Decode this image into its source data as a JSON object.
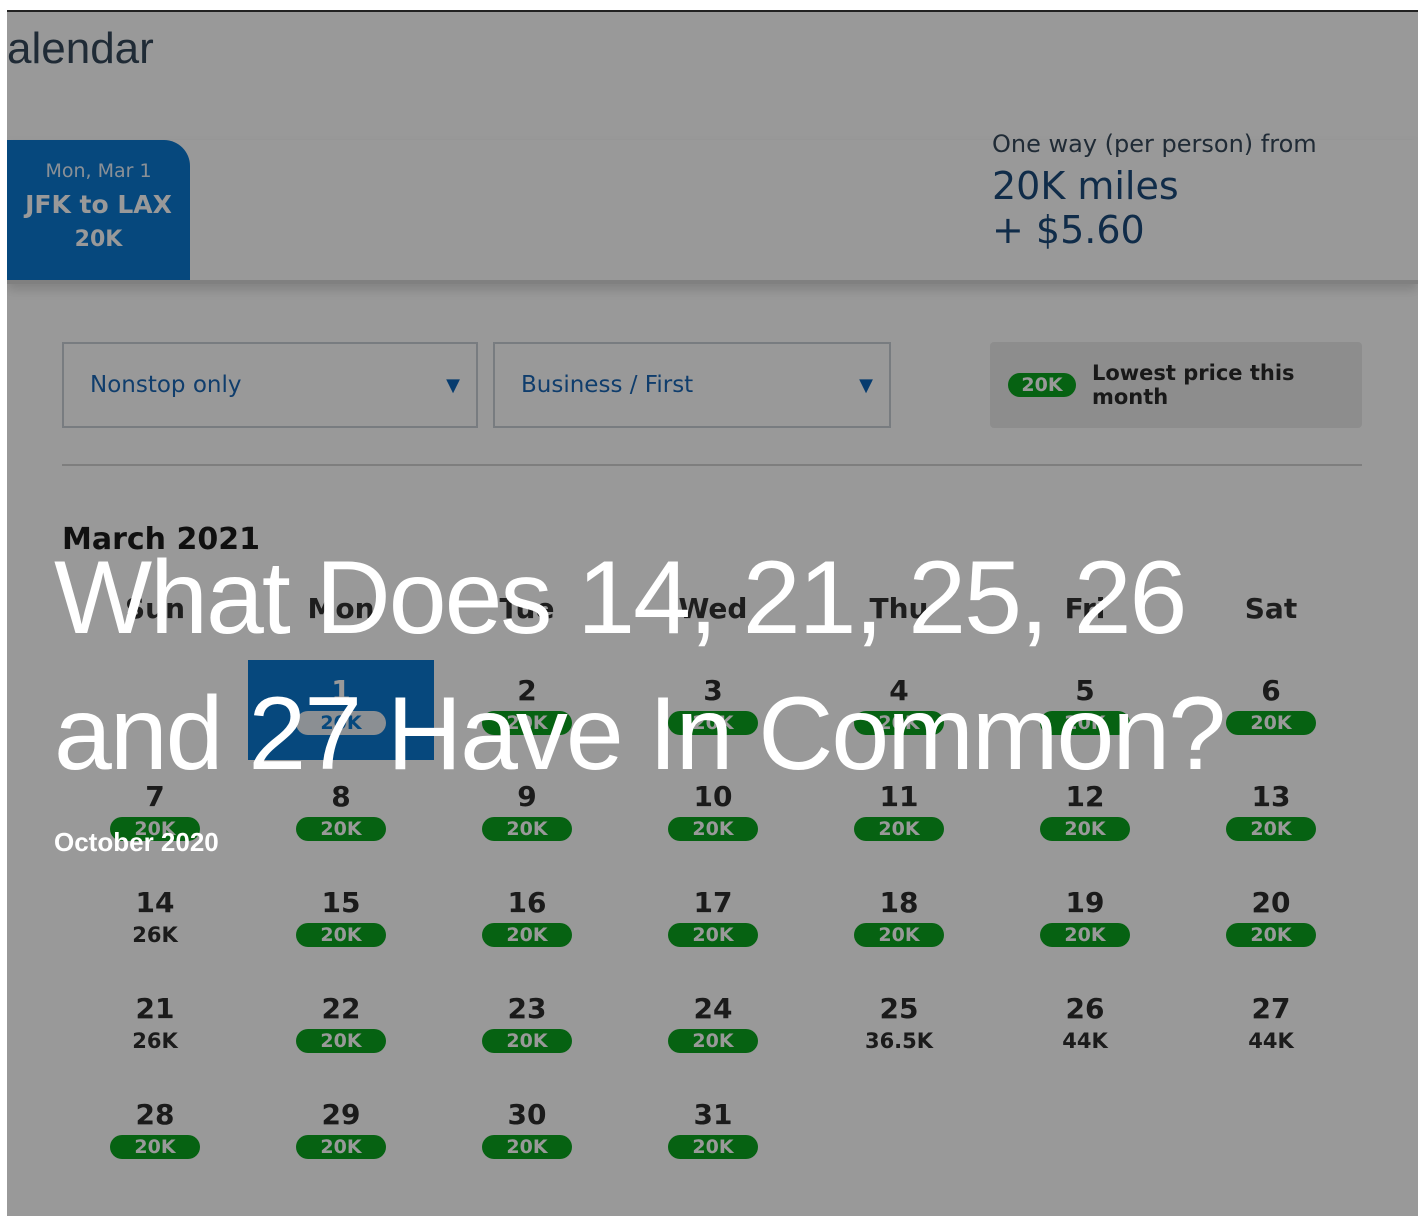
{
  "page": {
    "title_fragment": "alendar"
  },
  "flight_tab": {
    "date": "Mon, Mar 1",
    "route": "JFK to LAX",
    "price": "20K"
  },
  "fare": {
    "label": "One way (per person) from",
    "miles": "20K miles",
    "fee": "+ $5.60"
  },
  "filters": {
    "stops": "Nonstop only",
    "cabin": "Business / First"
  },
  "legend": {
    "pill": "20K",
    "text": "Lowest price this month"
  },
  "calendar": {
    "month": "March 2021",
    "weekdays": [
      "Sun",
      "Mon",
      "Tue",
      "Wed",
      "Thu",
      "Fri",
      "Sat"
    ],
    "days": [
      {
        "d": "1",
        "p": "20K",
        "pill": true,
        "sel": true
      },
      {
        "d": "2",
        "p": "20K",
        "pill": true
      },
      {
        "d": "3",
        "p": "20K",
        "pill": true
      },
      {
        "d": "4",
        "p": "20K",
        "pill": true
      },
      {
        "d": "5",
        "p": "20K",
        "pill": true
      },
      {
        "d": "6",
        "p": "20K",
        "pill": true
      },
      {
        "d": "7",
        "p": "20K",
        "pill": true
      },
      {
        "d": "8",
        "p": "20K",
        "pill": true
      },
      {
        "d": "9",
        "p": "20K",
        "pill": true
      },
      {
        "d": "10",
        "p": "20K",
        "pill": true
      },
      {
        "d": "11",
        "p": "20K",
        "pill": true
      },
      {
        "d": "12",
        "p": "20K",
        "pill": true
      },
      {
        "d": "13",
        "p": "20K",
        "pill": true
      },
      {
        "d": "14",
        "p": "26K",
        "pill": false
      },
      {
        "d": "15",
        "p": "20K",
        "pill": true
      },
      {
        "d": "16",
        "p": "20K",
        "pill": true
      },
      {
        "d": "17",
        "p": "20K",
        "pill": true
      },
      {
        "d": "18",
        "p": "20K",
        "pill": true
      },
      {
        "d": "19",
        "p": "20K",
        "pill": true
      },
      {
        "d": "20",
        "p": "20K",
        "pill": true
      },
      {
        "d": "21",
        "p": "26K",
        "pill": false
      },
      {
        "d": "22",
        "p": "20K",
        "pill": true
      },
      {
        "d": "23",
        "p": "20K",
        "pill": true
      },
      {
        "d": "24",
        "p": "20K",
        "pill": true
      },
      {
        "d": "25",
        "p": "36.5K",
        "pill": false
      },
      {
        "d": "26",
        "p": "44K",
        "pill": false
      },
      {
        "d": "27",
        "p": "44K",
        "pill": false
      },
      {
        "d": "28",
        "p": "20K",
        "pill": true
      },
      {
        "d": "29",
        "p": "20K",
        "pill": true
      },
      {
        "d": "30",
        "p": "20K",
        "pill": true
      },
      {
        "d": "31",
        "p": "20K",
        "pill": true
      }
    ]
  },
  "article": {
    "headline": "What Does 14, 21, 25, 26 and 27 Have In Common?",
    "date": "October 2020"
  }
}
